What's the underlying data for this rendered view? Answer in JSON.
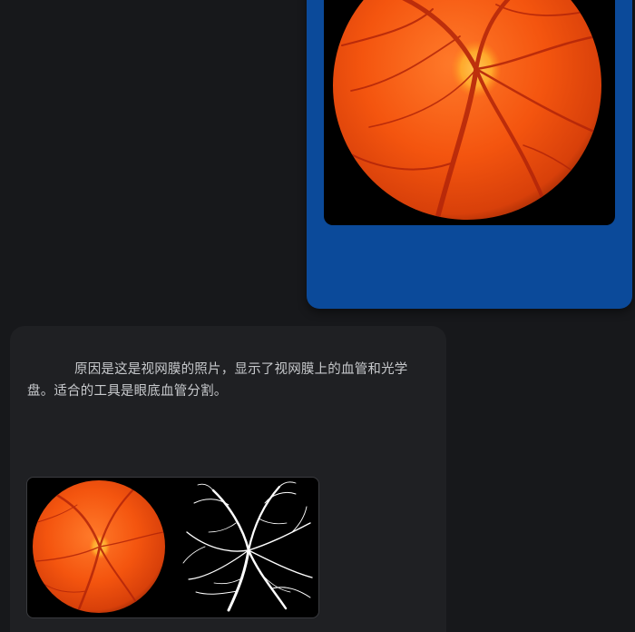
{
  "conversation": {
    "user_message": {
      "image_name": "retina-fundus-photo"
    },
    "assistant_message": {
      "text": "原因是这是视网膜的照片，显示了视网膜上的血管和光学盘。适合的工具是眼底血管分割。",
      "result_image": {
        "left_panel": "retina-fundus-photo",
        "right_panel": "vessel-segmentation-mask"
      }
    }
  },
  "colors": {
    "page_background": "#17181b",
    "user_bubble": "#0b4a9a",
    "assistant_bubble": "#1f2023",
    "text": "#c7c9cc",
    "fundus_orange": "#f05a12",
    "vessel_white": "#ffffff"
  }
}
